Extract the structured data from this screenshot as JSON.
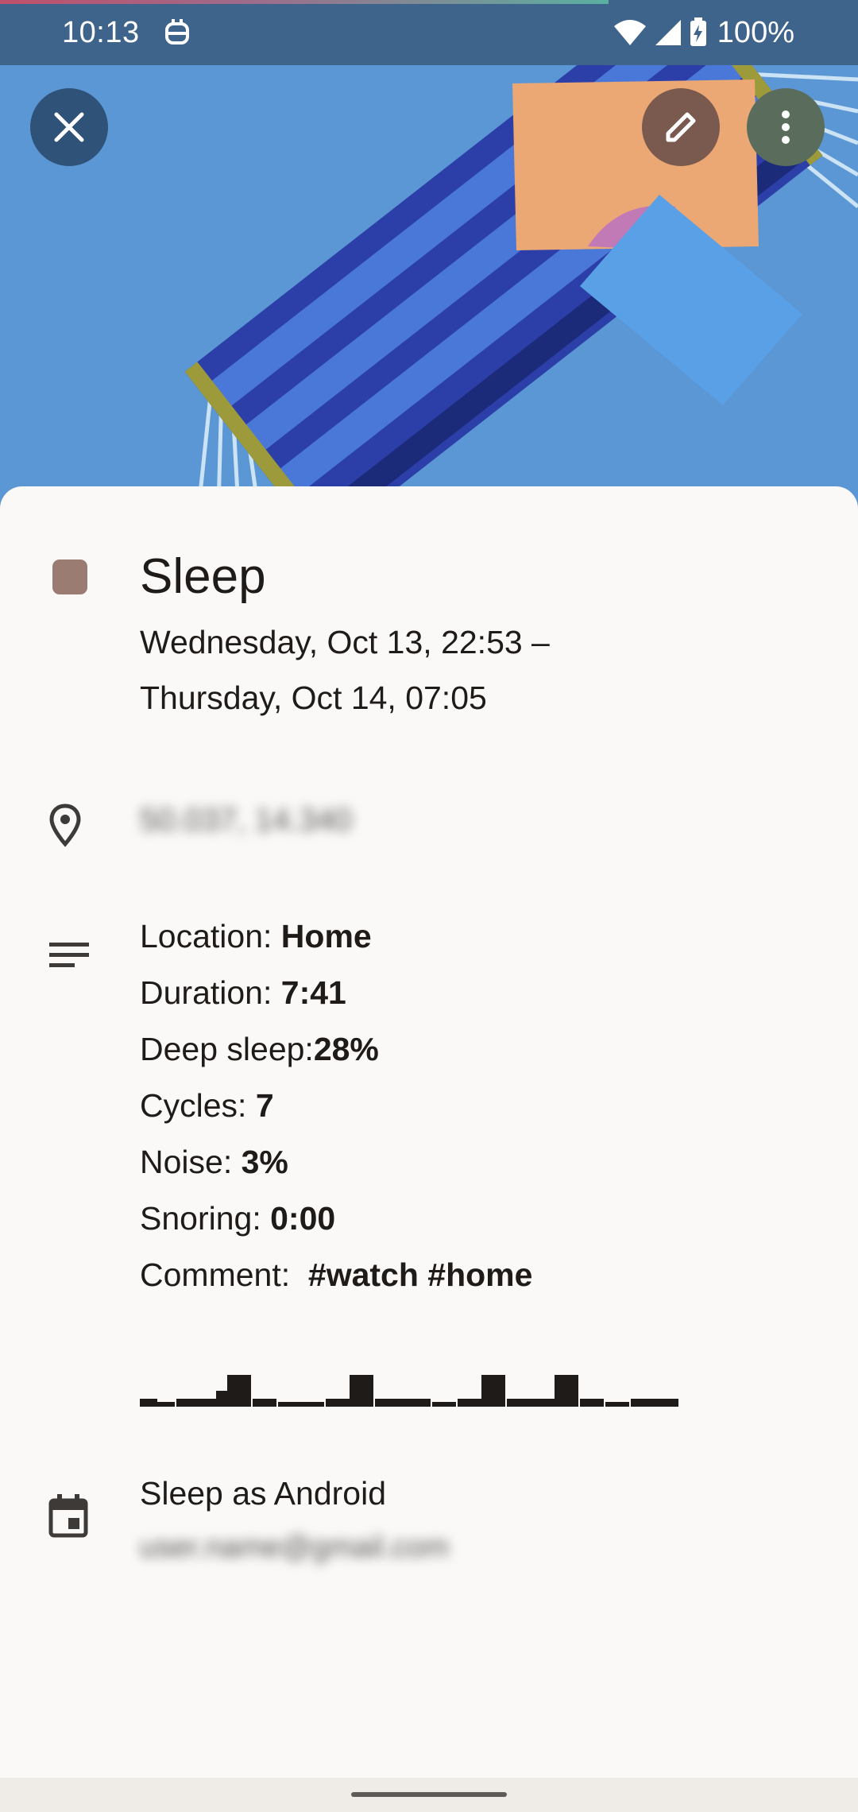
{
  "status_bar": {
    "time": "10:13",
    "battery": "100%"
  },
  "header": {
    "icons": [
      "close-icon",
      "edit-icon",
      "more-vert-icon"
    ]
  },
  "event": {
    "title": "Sleep",
    "color": "#9a7c73",
    "date_line1": "Wednesday, Oct 13, 22:53 –",
    "date_line2": "Thursday, Oct 14, 07:05",
    "location": "50.037, 14.340"
  },
  "description": {
    "location_label": "Location: ",
    "location_value": "Home",
    "duration_label": "Duration: ",
    "duration_value": "7:41",
    "deep_label": "Deep sleep:",
    "deep_value": "28%",
    "cycles_label": "Cycles: ",
    "cycles_value": "7",
    "noise_label": "Noise: ",
    "noise_value": "3%",
    "snoring_label": "Snoring: ",
    "snoring_value": "0:00",
    "comment_label": "Comment:  ",
    "comment_value": "#watch #home"
  },
  "calendar": {
    "name": "Sleep as Android",
    "account": "user.name@gmail.com"
  }
}
